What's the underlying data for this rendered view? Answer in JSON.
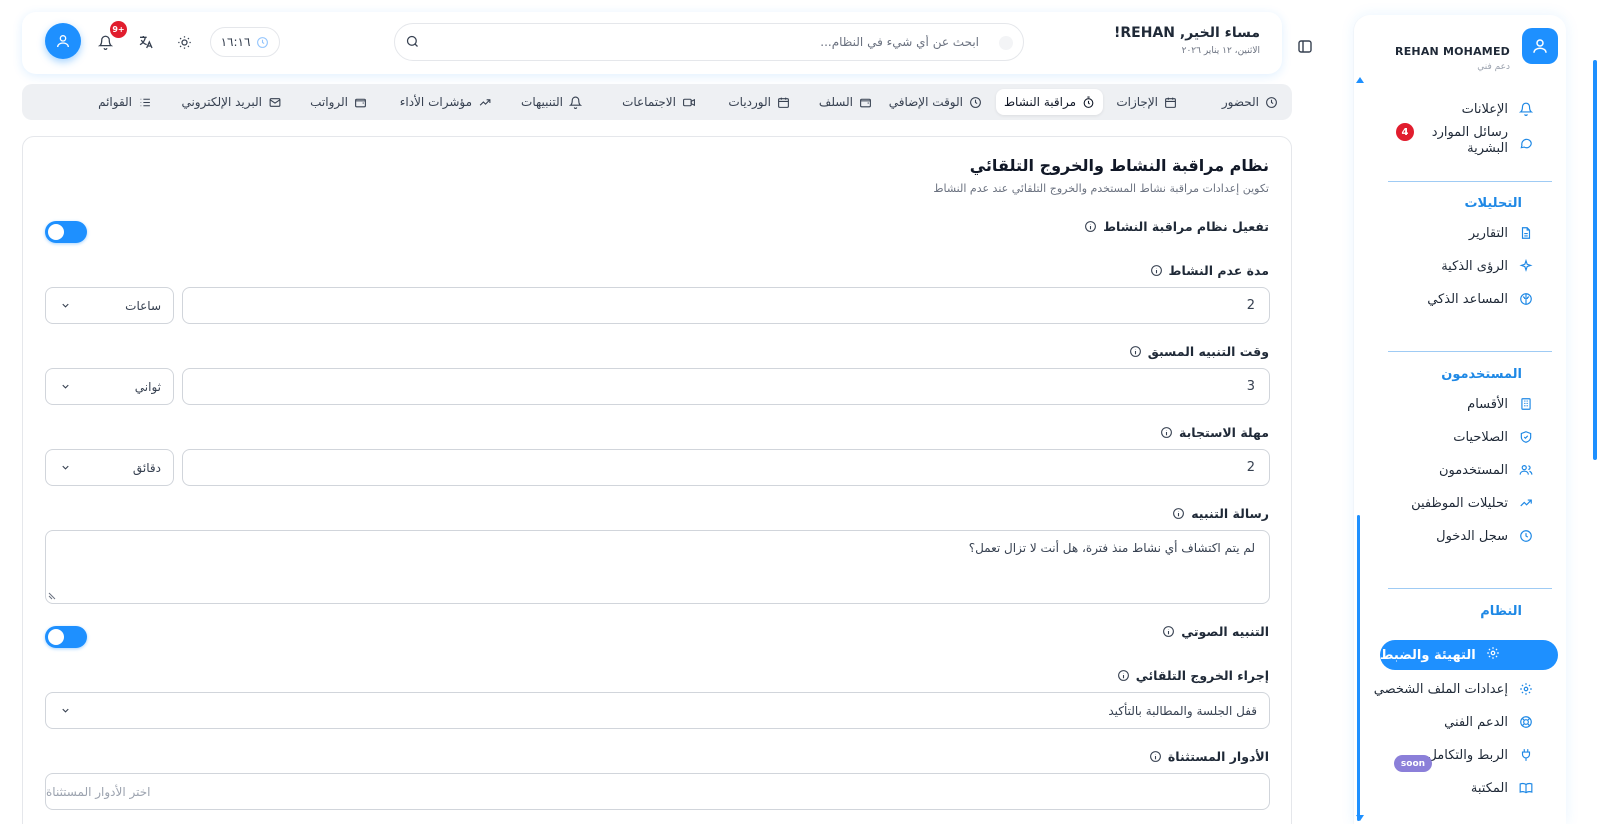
{
  "sidebar": {
    "user_name": "REHAN MOHAMED",
    "user_role": "دعم فني",
    "top_items": [
      {
        "label": "الإعلانات",
        "icon": "bell-icon"
      },
      {
        "label": "رسائل الموارد البشرية",
        "icon": "chat-icon",
        "badge": "4"
      }
    ],
    "sections": [
      {
        "title": "التحليلات",
        "items": [
          {
            "label": "التقارير",
            "icon": "document-icon"
          },
          {
            "label": "الرؤى الذكية",
            "icon": "sparkle-icon"
          },
          {
            "label": "المساعد الذكي",
            "icon": "brain-icon"
          }
        ]
      },
      {
        "title": "المستخدمون",
        "items": [
          {
            "label": "الأقسام",
            "icon": "building-icon"
          },
          {
            "label": "الصلاحيات",
            "icon": "shield-check-icon"
          },
          {
            "label": "المستخدمون",
            "icon": "users-icon"
          },
          {
            "label": "تحليلات الموظفين",
            "icon": "trend-up-icon"
          },
          {
            "label": "سجل الدخول",
            "icon": "clock-icon"
          }
        ]
      },
      {
        "title": "النظام",
        "items": [
          {
            "label": "التهيئة والضبط",
            "icon": "gear-icon",
            "active": true
          },
          {
            "label": "إعدادات الملف الشخصي",
            "icon": "gear-icon"
          },
          {
            "label": "الدعم الفني",
            "icon": "lifebuoy-icon"
          },
          {
            "label": "الربط والتكامل",
            "icon": "plug-icon",
            "badge": "soon"
          },
          {
            "label": "المكتبة",
            "icon": "book-icon"
          }
        ]
      }
    ],
    "accent": "#1e90ff"
  },
  "header": {
    "greeting": "مساء الخير, REHAN!",
    "date": "الاثنين، ١٢ يناير ٢٠٢٦",
    "search_placeholder": "ابحث عن أي شيء في النظام...",
    "time": "١٦:١٦",
    "notification_badge": "9+"
  },
  "tabs": [
    {
      "label": "الحضور",
      "icon": "clock-icon"
    },
    {
      "label": "الإجازات",
      "icon": "calendar-icon"
    },
    {
      "label": "مراقبة النشاط",
      "icon": "timer-icon",
      "active": true
    },
    {
      "label": "الوقت الإضافي",
      "icon": "clock-icon"
    },
    {
      "label": "السلف",
      "icon": "wallet-icon"
    },
    {
      "label": "الورديات",
      "icon": "calendar-icon"
    },
    {
      "label": "الاجتماعات",
      "icon": "video-icon"
    },
    {
      "label": "التنبيهات",
      "icon": "bell-icon"
    },
    {
      "label": "مؤشرات الأداء",
      "icon": "trend-up-icon"
    },
    {
      "label": "الرواتب",
      "icon": "wallet-icon"
    },
    {
      "label": "البريد الإلكتروني",
      "icon": "mail-icon"
    },
    {
      "label": "القوائم",
      "icon": "list-icon"
    }
  ],
  "card": {
    "title": "نظام مراقبة النشاط والخروج التلقائي",
    "subtitle": "تكوين إعدادات مراقبة نشاط المستخدم والخروج التلقائي عند عدم النشاط",
    "enable_label": "تفعيل نظام مراقبة النشاط",
    "inactivity_label": "مدة عدم النشاط",
    "inactivity_value": "2",
    "inactivity_unit": "ساعات",
    "warning_label": "وقت التنبيه المسبق",
    "warning_value": "3",
    "warning_unit": "ثواني",
    "response_label": "مهلة الاستجابة",
    "response_value": "2",
    "response_unit": "دقائق",
    "message_label": "رسالة التنبيه",
    "message_value": "لم يتم اكتشاف أي نشاط منذ فترة، هل أنت لا تزال تعمل؟",
    "sound_label": "التنبيه الصوتي",
    "logout_action_label": "إجراء الخروج التلقائي",
    "logout_action_value": "قفل الجلسة والمطالبة بالتأكيد",
    "excluded_roles_label": "الأدوار المستثناة",
    "excluded_roles_placeholder": "اختر الأدوار المستثناة"
  }
}
